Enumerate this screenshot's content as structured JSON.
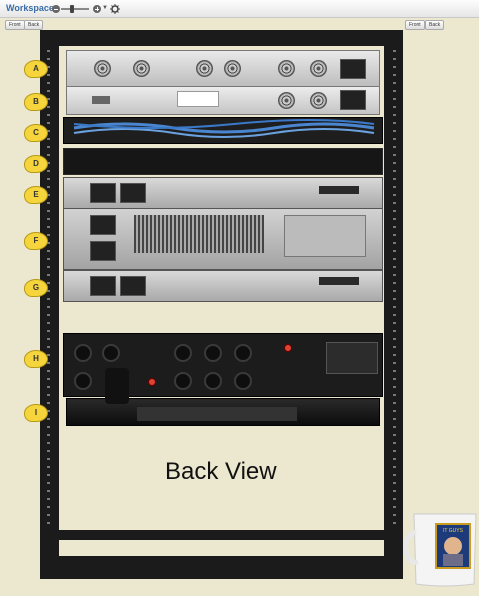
{
  "toolbar": {
    "title": "Workspace",
    "icons": [
      "zoom-out-icon",
      "zoom-slider",
      "zoom-in-icon",
      "settings-icon"
    ]
  },
  "view_buttons_left": {
    "front": "Front",
    "back": "Back"
  },
  "view_buttons_right": {
    "front": "Front",
    "back": "Back"
  },
  "rack_units": [
    "A",
    "B",
    "C",
    "D",
    "E",
    "F",
    "G",
    "H",
    "I"
  ],
  "view_label": "Back View",
  "mug": {
    "caption": "IT GUYS"
  },
  "colors": {
    "label_yellow": "#f6d53c",
    "title_blue": "#3a6ea5",
    "cable_blue": "#3a78c8",
    "rack_black": "#1b1b1b"
  }
}
